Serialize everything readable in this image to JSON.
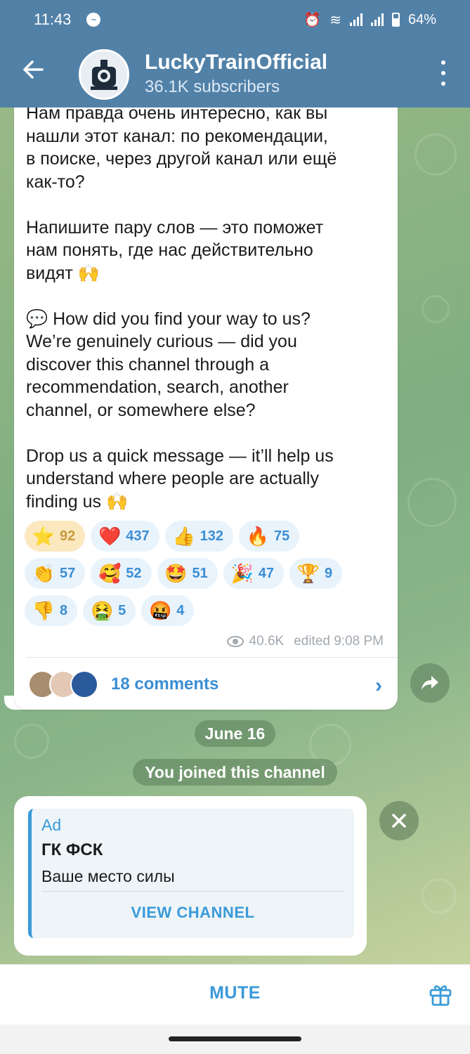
{
  "status_bar": {
    "time": "11:43",
    "battery": "64%"
  },
  "header": {
    "channel_name": "LuckyTrainOfficial",
    "subscribers": "36.1K subscribers"
  },
  "message": {
    "text": "Нам правда очень интересно, как вы\nнашли этот канал: по рекомендации,\nв поиске, через другой канал или ещё\nкак-то?\n\nНапишите пару слов — это поможет\nнам понять, где нас действительно\nвидят 🙌\n\n💬 How did you find your way to us?\nWe’re genuinely curious — did you\ndiscover this channel through a\nrecommendation, search, another\nchannel, or somewhere else?\n\nDrop us a quick message — it’ll help us\nunderstand where people are actually\nfinding us 🙌",
    "reactions": [
      {
        "emoji": "⭐",
        "count": "92",
        "active": true
      },
      {
        "emoji": "❤️",
        "count": "437"
      },
      {
        "emoji": "👍",
        "count": "132"
      },
      {
        "emoji": "🔥",
        "count": "75"
      },
      {
        "emoji": "👏",
        "count": "57"
      },
      {
        "emoji": "🥰",
        "count": "52"
      },
      {
        "emoji": "🤩",
        "count": "51"
      },
      {
        "emoji": "🎉",
        "count": "47"
      },
      {
        "emoji": "🏆",
        "count": "9"
      },
      {
        "emoji": "👎",
        "count": "8"
      },
      {
        "emoji": "🤮",
        "count": "5"
      },
      {
        "emoji": "🤬",
        "count": "4"
      }
    ],
    "views": "40.6K",
    "edited": "edited 9:08 PM",
    "comments": "18 comments"
  },
  "date_pill": "June 16",
  "service_message": "You joined this channel",
  "ad": {
    "label": "Ad",
    "title": "ГК ФСК",
    "description": "Ваше место силы",
    "button": "VIEW CHANNEL"
  },
  "bottom": {
    "mute": "MUTE"
  },
  "colors": {
    "header": "#5281a8",
    "accent": "#3a9ad9",
    "active_reaction": "#fbe8bf"
  }
}
